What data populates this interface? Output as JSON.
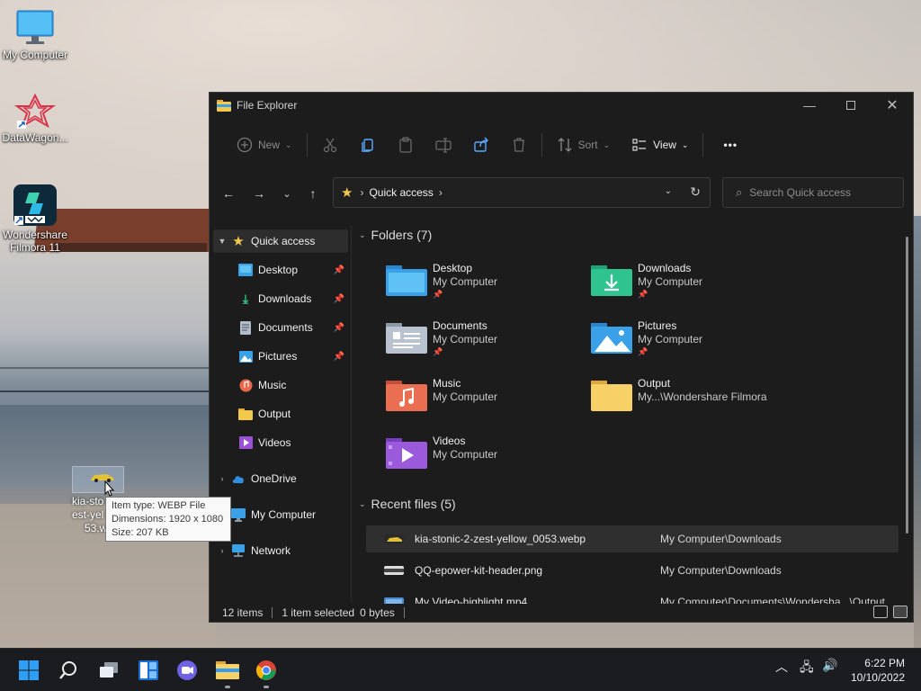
{
  "desktop": {
    "icons": [
      {
        "label": "My Computer"
      },
      {
        "label": "DataWagon..."
      },
      {
        "label": "Wondershare Filmora 11"
      }
    ],
    "dragged_file_label_1": "kia-sto",
    "dragged_file_label_2": "est-yel",
    "dragged_file_label_3": "53.w"
  },
  "tooltip": {
    "type": "Item type: WEBP File",
    "dimensions": "Dimensions: 1920 x 1080",
    "size": "Size: 207 KB"
  },
  "window": {
    "title": "File Explorer",
    "toolbar": {
      "new_label": "New",
      "sort_label": "Sort",
      "view_label": "View",
      "more_label": "•••"
    },
    "address": {
      "crumb": "Quick access"
    },
    "search": {
      "placeholder": "Search Quick access"
    },
    "sidebar": {
      "items": [
        {
          "label": "Quick access"
        },
        {
          "label": "Desktop"
        },
        {
          "label": "Downloads"
        },
        {
          "label": "Documents"
        },
        {
          "label": "Pictures"
        },
        {
          "label": "Music"
        },
        {
          "label": "Output"
        },
        {
          "label": "Videos"
        },
        {
          "label": "OneDrive"
        },
        {
          "label": "My Computer"
        },
        {
          "label": "Network"
        }
      ]
    },
    "folders_header": "Folders (7)",
    "folders": [
      {
        "name": "Desktop",
        "location": "My Computer"
      },
      {
        "name": "Downloads",
        "location": "My Computer"
      },
      {
        "name": "Documents",
        "location": "My Computer"
      },
      {
        "name": "Pictures",
        "location": "My Computer"
      },
      {
        "name": "Music",
        "location": "My Computer"
      },
      {
        "name": "Output",
        "location": "My...\\Wondershare Filmora"
      },
      {
        "name": "Videos",
        "location": "My Computer"
      }
    ],
    "recent_header": "Recent files (5)",
    "recent_files": [
      {
        "name": "kia-stonic-2-zest-yellow_0053.webp",
        "location": "My Computer\\Downloads"
      },
      {
        "name": "QQ-epower-kit-header.png",
        "location": "My Computer\\Downloads"
      },
      {
        "name": "My Video-highlight.mp4",
        "location": "My Computer\\Documents\\Wondersha...\\Output"
      }
    ],
    "status": {
      "items": "12 items",
      "selected": "1 item selected",
      "size": "0 bytes"
    }
  },
  "taskbar": {
    "time": "6:22 PM",
    "date": "10/10/2022"
  },
  "colors": {
    "window_bg": "#1c1c1c",
    "taskbar_bg": "#1b1c1f",
    "folder_yellow": "#f2c94c",
    "accent_blue": "#3aa0e8"
  }
}
